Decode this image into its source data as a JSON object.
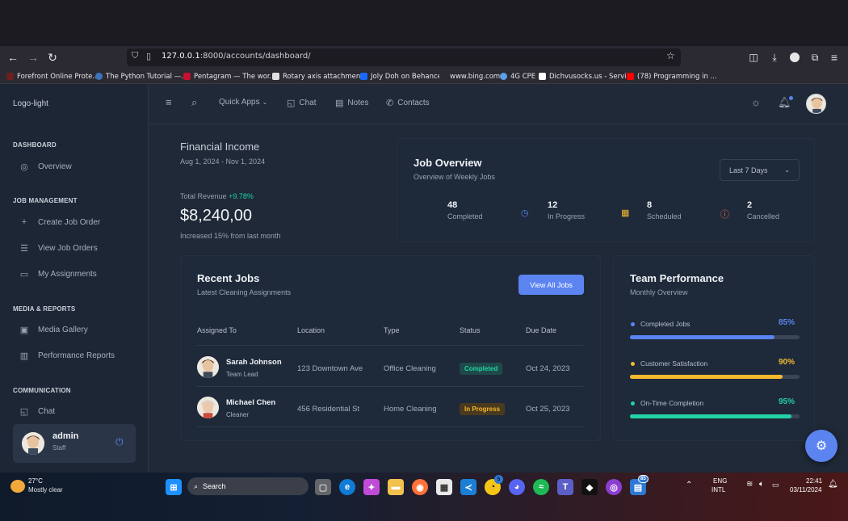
{
  "browser": {
    "url_host": "127.0.0.1",
    "url_rest": ":8000/accounts/dashboard/",
    "bookmarks": [
      "Forefront Online Prote...",
      "The Python Tutorial —...",
      "Pentagram — The wor...",
      "Rotary axis attachmen...",
      "Joly Doh on Behance",
      "www.bing.com",
      "4G CPE",
      "Dichvusocks.us - Servi...",
      "(78) Programming in ..."
    ]
  },
  "sidebar": {
    "logo": "Logo-light",
    "sections": {
      "dashboard": "DASHBOARD",
      "job_management": "JOB MANAGEMENT",
      "media_reports": "MEDIA & REPORTS",
      "communication": "COMMUNICATION"
    },
    "items": {
      "overview": "Overview",
      "create_job_order": "Create Job Order",
      "view_job_orders": "View Job Orders",
      "my_assignments": "My Assignments",
      "media_gallery": "Media Gallery",
      "performance_reports": "Performance Reports",
      "chat": "Chat"
    },
    "user": {
      "name": "admin",
      "role": "Staff"
    }
  },
  "topbar": {
    "quick_apps": "Quick Apps",
    "chat": "Chat",
    "notes": "Notes",
    "contacts": "Contacts"
  },
  "financial": {
    "title": "Financial Income",
    "date_range": "Aug 1, 2024 - Nov 1, 2024",
    "total_label": "Total Revenue",
    "change": "+9.78%",
    "amount": "$8,240,00",
    "note": "Increased 15% from last month"
  },
  "job_overview": {
    "title": "Job Overview",
    "subtitle": "Overview of Weekly Jobs",
    "range": "Last 7 Days",
    "stats": [
      {
        "value": "48",
        "label": "Completed",
        "color": "#5b84f1"
      },
      {
        "value": "12",
        "label": "In Progress",
        "color": "#f5b82e"
      },
      {
        "value": "8",
        "label": "Scheduled",
        "color": "#f46a4e"
      },
      {
        "value": "2",
        "label": "Cancelled",
        "color": "#f46a4e"
      }
    ]
  },
  "recent_jobs": {
    "title": "Recent Jobs",
    "subtitle": "Latest Cleaning Assignments",
    "button": "View All Jobs",
    "columns": [
      "Assigned To",
      "Location",
      "Type",
      "Status",
      "Due Date"
    ],
    "rows": [
      {
        "name": "Sarah Johnson",
        "role": "Team Lead",
        "location": "123 Downtown Ave",
        "type": "Office Cleaning",
        "status": "Completed",
        "due": "Oct 24, 2023"
      },
      {
        "name": "Michael Chen",
        "role": "Cleaner",
        "location": "456 Residential St",
        "type": "Home Cleaning",
        "status": "In Progress",
        "due": "Oct 25, 2023"
      }
    ]
  },
  "team_performance": {
    "title": "Team Performance",
    "subtitle": "Monthly Overview",
    "metrics": [
      {
        "label": "Completed Jobs",
        "value": "85%",
        "fraction": 0.85,
        "color": "#5b84f1"
      },
      {
        "label": "Customer Satisfaction",
        "value": "90%",
        "fraction": 0.9,
        "color": "#f5b82e"
      },
      {
        "label": "On-Time Completion",
        "value": "95%",
        "fraction": 0.95,
        "color": "#22d3a4"
      }
    ]
  },
  "taskbar": {
    "temp": "27°C",
    "weather": "Mostly clear",
    "search": "Search",
    "lang1": "ENG",
    "lang2": "INTL",
    "time": "22:41",
    "date": "03/11/2024",
    "badge_whatsapp": "5",
    "badge_store": "85"
  }
}
